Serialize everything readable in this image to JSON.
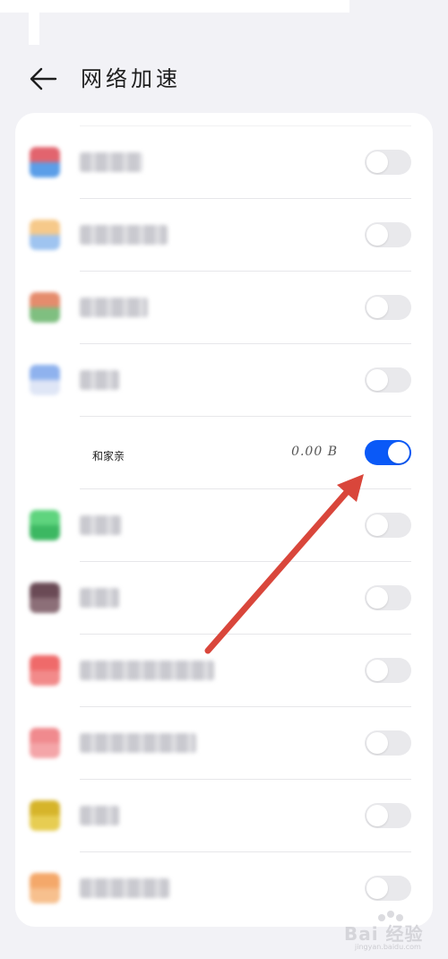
{
  "header": {
    "title": "网络加速",
    "back_icon": "arrow-left-icon"
  },
  "apps": [
    {
      "name": "",
      "blurred": true,
      "icon_colors": [
        "#e2646e",
        "#5b9ee8"
      ],
      "name_width": 70,
      "enabled": false
    },
    {
      "name": "",
      "blurred": true,
      "icon_colors": [
        "#f6c98a",
        "#9fc4f0"
      ],
      "name_width": 98,
      "enabled": false
    },
    {
      "name": "",
      "blurred": true,
      "icon_colors": [
        "#e58c6d",
        "#7fbf80"
      ],
      "name_width": 76,
      "enabled": false
    },
    {
      "name": "",
      "blurred": true,
      "icon_colors": [
        "#8fb2ee",
        "#dfe6f6"
      ],
      "name_width": 44,
      "enabled": false
    },
    {
      "name": "和家亲",
      "blurred": false,
      "icon_colors": [],
      "usage": "0.00 B",
      "enabled": true
    },
    {
      "name": "",
      "blurred": true,
      "icon_colors": [
        "#5fd47e",
        "#3cb862"
      ],
      "name_width": 46,
      "enabled": false
    },
    {
      "name": "",
      "blurred": true,
      "icon_colors": [
        "#6a4a55",
        "#8c6f78"
      ],
      "name_width": 44,
      "enabled": false
    },
    {
      "name": "",
      "blurred": true,
      "icon_colors": [
        "#ef6a6a",
        "#f28a8a"
      ],
      "name_width": 150,
      "enabled": false
    },
    {
      "name": "",
      "blurred": true,
      "icon_colors": [
        "#f08a8e",
        "#f4a5a8"
      ],
      "name_width": 130,
      "enabled": false
    },
    {
      "name": "",
      "blurred": true,
      "icon_colors": [
        "#d6b42a",
        "#e7cd52"
      ],
      "name_width": 44,
      "enabled": false
    },
    {
      "name": "",
      "blurred": true,
      "icon_colors": [
        "#f4a86a",
        "#f7c08e"
      ],
      "name_width": 100,
      "enabled": false
    }
  ],
  "annotation": {
    "arrow_color": "#d9463b"
  },
  "watermark": {
    "text": "Bai 经验",
    "sub": "jingyan.baidu.com"
  }
}
